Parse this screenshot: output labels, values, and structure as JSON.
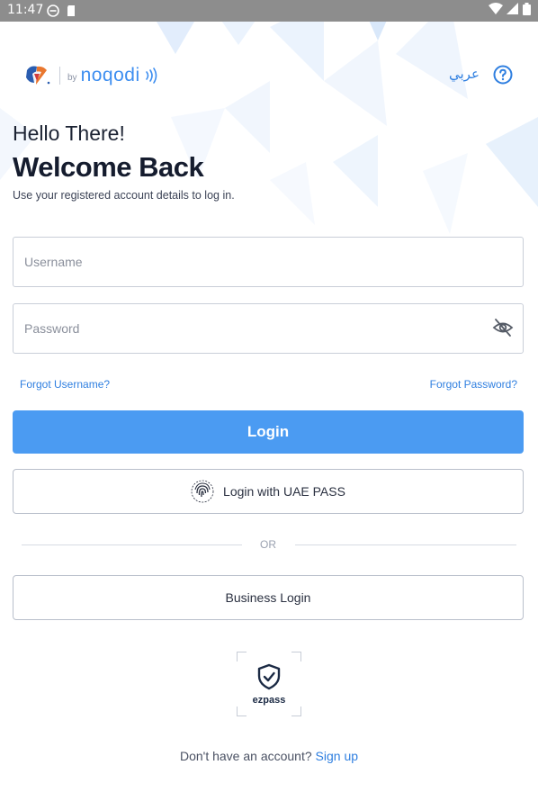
{
  "status_bar": {
    "time": "11:47"
  },
  "header": {
    "logo_by": "by",
    "logo_brand": "noqodi",
    "language_label": "عربي",
    "help_icon": "question-circle-icon"
  },
  "greeting": {
    "hello": "Hello There!",
    "title": "Welcome Back",
    "subtitle": "Use your registered account details to log in."
  },
  "form": {
    "username_placeholder": "Username",
    "password_placeholder": "Password",
    "password_toggle_icon": "eye-off-icon",
    "forgot_username": "Forgot Username?",
    "forgot_password": "Forgot Password?",
    "login_label": "Login",
    "uae_pass_label": "Login with UAE PASS",
    "or_label": "OR",
    "business_login_label": "Business Login"
  },
  "ezpass": {
    "label": "ezpass",
    "icon": "shield-check-icon"
  },
  "footer": {
    "prompt": "Don't have an account?",
    "signup_label": "Sign up"
  },
  "colors": {
    "accent": "#4b9bf2",
    "link": "#2f7fe0",
    "status_bar": "#8d8d8d"
  }
}
